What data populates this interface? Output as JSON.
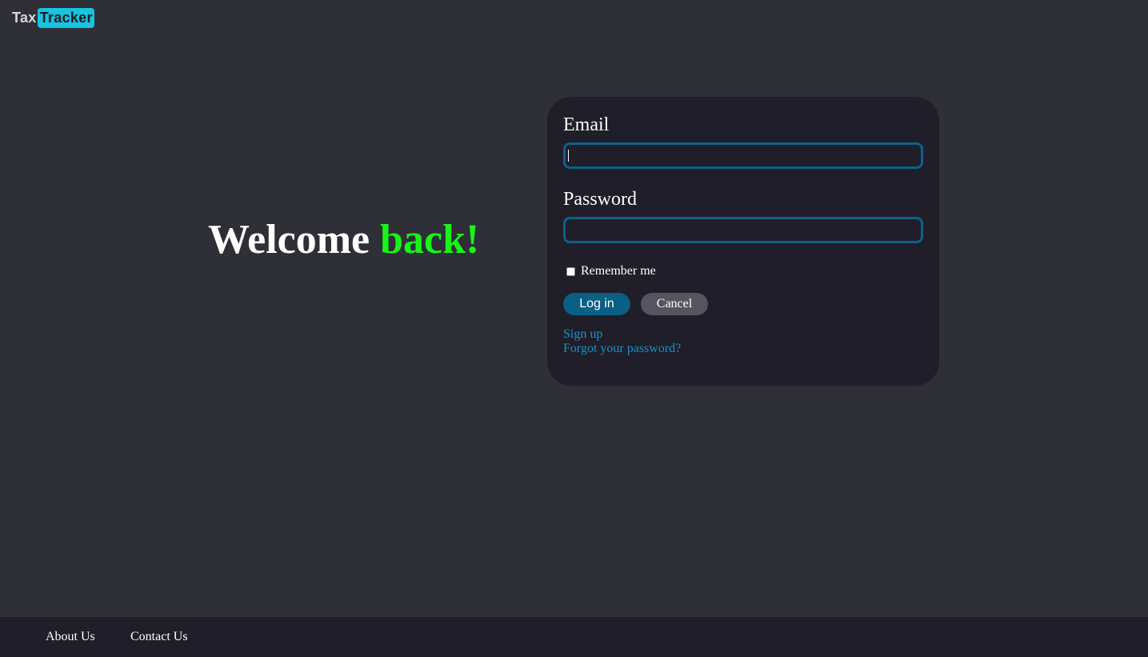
{
  "brand": {
    "logo_part1": "Tax",
    "logo_part2": "Tracker",
    "accent_color": "#17c3e0"
  },
  "hero": {
    "welcome_word": "Welcome",
    "welcome_accent": "back!",
    "accent_color": "#19f519"
  },
  "login_form": {
    "email_label": "Email",
    "email_value": "",
    "password_label": "Password",
    "password_value": "",
    "remember_label": "Remember me",
    "remember_checked": false,
    "login_button": "Log in",
    "cancel_button": "Cancel",
    "signup_link": "Sign up",
    "forgot_link": "Forgot your password?",
    "input_border_color": "#0d6189",
    "link_color": "#1b91c8"
  },
  "footer": {
    "links": [
      "About Us",
      "Contact Us"
    ]
  }
}
